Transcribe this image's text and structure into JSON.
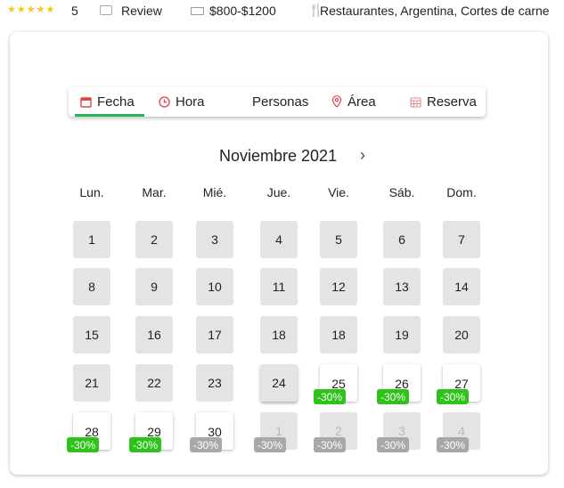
{
  "info": {
    "stars": "★★★★★",
    "rating": "5",
    "review_label": "Review",
    "price": "$800-$1200",
    "categories": "Restaurantes, Argentina, Cortes de carne"
  },
  "tabs": [
    {
      "label": "Fecha",
      "icon": "calendar-icon",
      "active": true
    },
    {
      "label": "Hora",
      "icon": "clock-icon",
      "active": false
    },
    {
      "label": "Personas",
      "icon": "",
      "active": false
    },
    {
      "label": "Área",
      "icon": "location-pin-icon",
      "active": false
    },
    {
      "label": "Reserva",
      "icon": "calendar-grid-icon",
      "active": false
    }
  ],
  "calendar": {
    "month_title": "Noviembre 2021",
    "next_label": "›",
    "weekdays": [
      "Lun.",
      "Mar.",
      "Mié.",
      "Jue.",
      "Vie.",
      "Sáb.",
      "Dom."
    ],
    "rows": [
      [
        {
          "day": "1",
          "style": "grey"
        },
        {
          "day": "2",
          "style": "grey"
        },
        {
          "day": "3",
          "style": "grey"
        },
        {
          "day": "4",
          "style": "grey"
        },
        {
          "day": "5",
          "style": "grey"
        },
        {
          "day": "6",
          "style": "grey"
        },
        {
          "day": "7",
          "style": "grey"
        }
      ],
      [
        {
          "day": "8",
          "style": "grey"
        },
        {
          "day": "9",
          "style": "grey"
        },
        {
          "day": "10",
          "style": "grey"
        },
        {
          "day": "11",
          "style": "grey"
        },
        {
          "day": "12",
          "style": "grey"
        },
        {
          "day": "13",
          "style": "grey"
        },
        {
          "day": "14",
          "style": "grey"
        }
      ],
      [
        {
          "day": "15",
          "style": "grey"
        },
        {
          "day": "16",
          "style": "grey"
        },
        {
          "day": "17",
          "style": "grey"
        },
        {
          "day": "18",
          "style": "grey"
        },
        {
          "day": "18",
          "style": "grey"
        },
        {
          "day": "19",
          "style": "grey"
        },
        {
          "day": "20",
          "style": "grey"
        }
      ],
      [
        {
          "day": "21",
          "style": "grey"
        },
        {
          "day": "22",
          "style": "grey"
        },
        {
          "day": "23",
          "style": "grey"
        },
        {
          "day": "24",
          "style": "grey-sel"
        },
        {
          "day": "25",
          "style": "white",
          "badge": "-30%",
          "badge_color": "#2ec21a"
        },
        {
          "day": "26",
          "style": "white",
          "badge": "-30%",
          "badge_color": "#2ec21a"
        },
        {
          "day": "27",
          "style": "white",
          "badge": "-30%",
          "badge_color": "#2ec21a"
        }
      ],
      [
        {
          "day": "28",
          "style": "white",
          "badge": "-30%",
          "badge_color": "#2ec21a"
        },
        {
          "day": "29",
          "style": "white",
          "badge": "-30%",
          "badge_color": "#2ec21a"
        },
        {
          "day": "30",
          "style": "white",
          "badge": "-30%",
          "badge_color": "#a8a8a8"
        },
        {
          "day": "1",
          "style": "dim",
          "badge": "-30%",
          "badge_color": "#a8a8a8"
        },
        {
          "day": "2",
          "style": "dim",
          "badge": "-30%",
          "badge_color": "#a8a8a8"
        },
        {
          "day": "3",
          "style": "dim",
          "badge": "-30%",
          "badge_color": "#a8a8a8"
        },
        {
          "day": "4",
          "style": "dim",
          "badge": "-30%",
          "badge_color": "#a8a8a8"
        }
      ]
    ]
  },
  "colors": {
    "accent_red": "#e0454b",
    "active_tab_underline": "#2ab45a",
    "discount_green": "#2ec21a",
    "discount_grey": "#a8a8a8",
    "star_yellow": "#f5c518"
  }
}
